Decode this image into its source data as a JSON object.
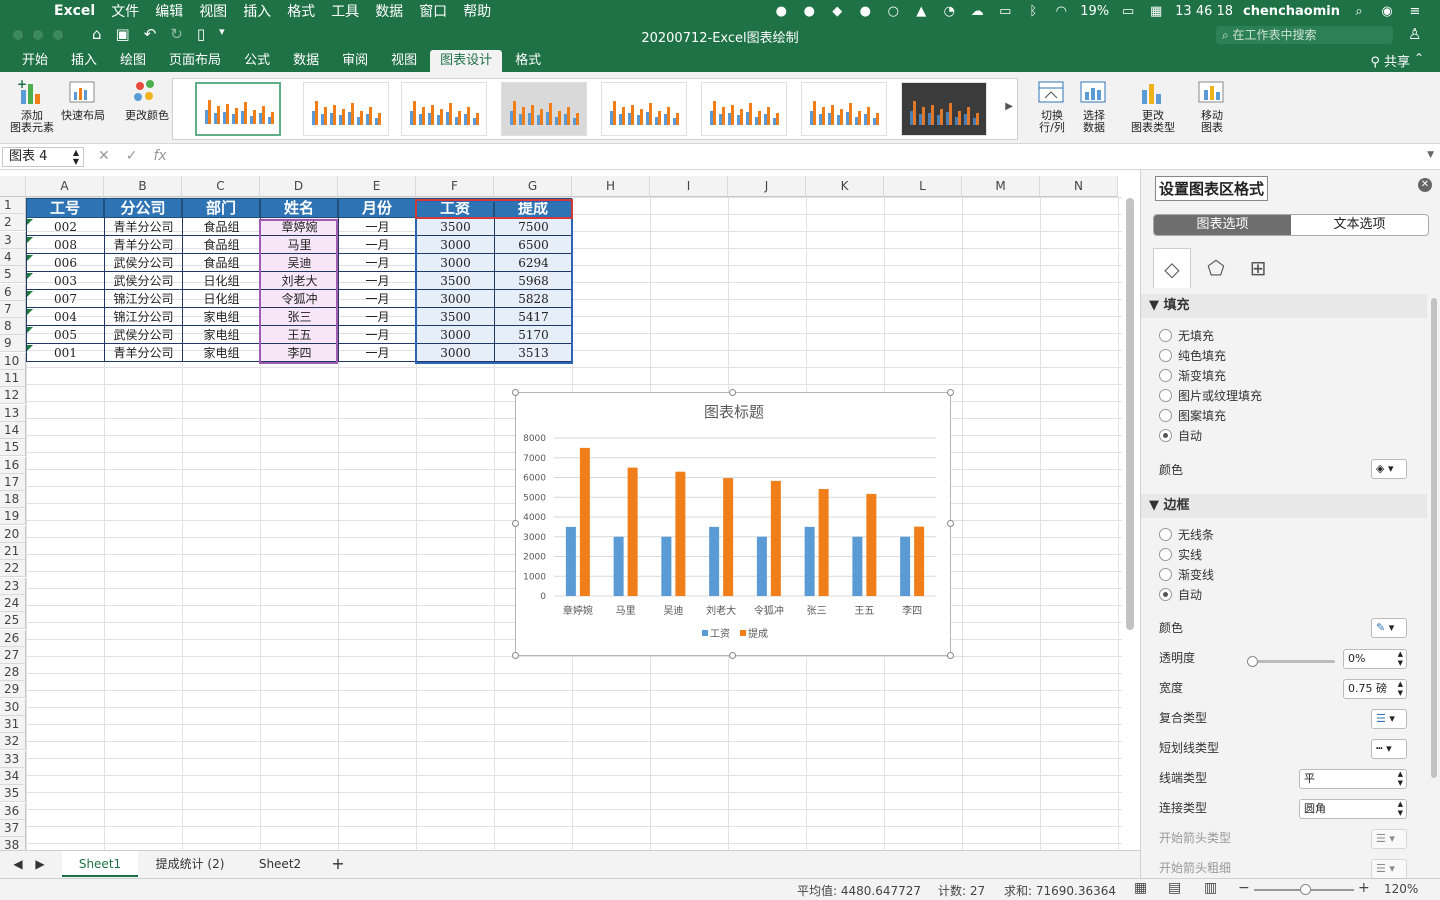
{
  "menubar": {
    "app": "Excel",
    "items": [
      "文件",
      "编辑",
      "视图",
      "插入",
      "格式",
      "工具",
      "数据",
      "窗口",
      "帮助"
    ],
    "battery": "19%",
    "time": "13 46 18",
    "user": "chenchaomin"
  },
  "window": {
    "title": "20200712-Excel图表绘制",
    "search_placeholder": "在工作表中搜索"
  },
  "ribbon_tabs": [
    {
      "label": "开始",
      "active": false
    },
    {
      "label": "插入",
      "active": false
    },
    {
      "label": "绘图",
      "active": false
    },
    {
      "label": "页面布局",
      "active": false
    },
    {
      "label": "公式",
      "active": false
    },
    {
      "label": "数据",
      "active": false
    },
    {
      "label": "审阅",
      "active": false
    },
    {
      "label": "视图",
      "active": false
    },
    {
      "label": "图表设计",
      "active": true
    },
    {
      "label": "格式",
      "active": false
    }
  ],
  "share_label": "共享",
  "ribbon": {
    "add_element": {
      "line1": "添加",
      "line2": "图表元素"
    },
    "quick_layout": "快速布局",
    "change_colors": "更改颜色",
    "switch": {
      "line1": "切换",
      "line2": "行/列"
    },
    "select_data": {
      "line1": "选择",
      "line2": "数据"
    },
    "change_type": {
      "line1": "更改",
      "line2": "图表类型"
    },
    "move_chart": {
      "line1": "移动",
      "line2": "图表"
    }
  },
  "formula_bar": {
    "name_box": "图表 4",
    "fx": "fx",
    "content": ""
  },
  "columns": [
    "A",
    "B",
    "C",
    "D",
    "E",
    "F",
    "G",
    "H",
    "I",
    "J",
    "K",
    "L",
    "M",
    "N"
  ],
  "rows": [
    "1",
    "2",
    "3",
    "4",
    "5",
    "6",
    "7",
    "8",
    "9",
    "10",
    "11",
    "12",
    "13",
    "14",
    "15",
    "16",
    "17",
    "18",
    "19",
    "20",
    "21",
    "22",
    "23",
    "24",
    "25",
    "26",
    "27",
    "28",
    "29",
    "30",
    "31",
    "32",
    "33",
    "34",
    "35",
    "36",
    "37",
    "38"
  ],
  "table": {
    "headers": [
      "工号",
      "分公司",
      "部门",
      "姓名",
      "月份",
      "工资",
      "提成"
    ],
    "rows": [
      [
        "002",
        "青羊分公司",
        "食品组",
        "章婷婉",
        "一月",
        "3500",
        "7500"
      ],
      [
        "008",
        "青羊分公司",
        "食品组",
        "马里",
        "一月",
        "3000",
        "6500"
      ],
      [
        "006",
        "武侯分公司",
        "食品组",
        "吴迪",
        "一月",
        "3000",
        "6294"
      ],
      [
        "003",
        "武侯分公司",
        "日化组",
        "刘老大",
        "一月",
        "3500",
        "5968"
      ],
      [
        "007",
        "锦江分公司",
        "日化组",
        "令狐冲",
        "一月",
        "3000",
        "5828"
      ],
      [
        "004",
        "锦江分公司",
        "家电组",
        "张三",
        "一月",
        "3500",
        "5417"
      ],
      [
        "005",
        "武侯分公司",
        "家电组",
        "王五",
        "一月",
        "3000",
        "5170"
      ],
      [
        "001",
        "青羊分公司",
        "家电组",
        "李四",
        "一月",
        "3000",
        "3513"
      ]
    ]
  },
  "chart_data": {
    "type": "bar",
    "title": "图表标题",
    "categories": [
      "章婷婉",
      "马里",
      "吴迪",
      "刘老大",
      "令狐冲",
      "张三",
      "王五",
      "李四"
    ],
    "series": [
      {
        "name": "工资",
        "values": [
          3500,
          3000,
          3000,
          3500,
          3000,
          3500,
          3000,
          3000
        ],
        "color": "#5b9bd5"
      },
      {
        "name": "提成",
        "values": [
          7500,
          6500,
          6294,
          5968,
          5828,
          5417,
          5170,
          3513
        ],
        "color": "#f07f1a"
      }
    ],
    "yticks": [
      "0",
      "1000",
      "2000",
      "3000",
      "4000",
      "5000",
      "6000",
      "7000",
      "8000"
    ],
    "ylim": [
      0,
      8000
    ],
    "grid": true,
    "legend": "bottom"
  },
  "sheet_tabs": [
    {
      "label": "Sheet1",
      "active": true
    },
    {
      "label": "提成统计 (2)",
      "active": false
    },
    {
      "label": "Sheet2",
      "active": false
    }
  ],
  "add_sheet": "+",
  "status": {
    "average": "平均值: 4480.647727",
    "count": "计数: 27",
    "sum": "求和: 71690.36364",
    "zoom": "120%"
  },
  "pane": {
    "title": "设置图表区格式",
    "tab_chart": "图表选项",
    "tab_text": "文本选项",
    "fill_section": "填充",
    "fill_options": [
      "无填充",
      "纯色填充",
      "渐变填充",
      "图片或纹理填充",
      "图案填充",
      "自动"
    ],
    "fill_selected": 5,
    "color_label": "颜色",
    "border_section": "边框",
    "border_options": [
      "无线条",
      "实线",
      "渐变线",
      "自动"
    ],
    "border_selected": 3,
    "border_color_label": "颜色",
    "transparency_label": "透明度",
    "transparency_value": "0%",
    "width_label": "宽度",
    "width_value": "0.75 磅",
    "compound_label": "复合类型",
    "dash_label": "短划线类型",
    "cap_label": "线端类型",
    "cap_value": "平",
    "join_label": "连接类型",
    "join_value": "圆角",
    "arrow_begin_type": "开始箭头类型",
    "arrow_begin_size": "开始箭头粗细"
  }
}
